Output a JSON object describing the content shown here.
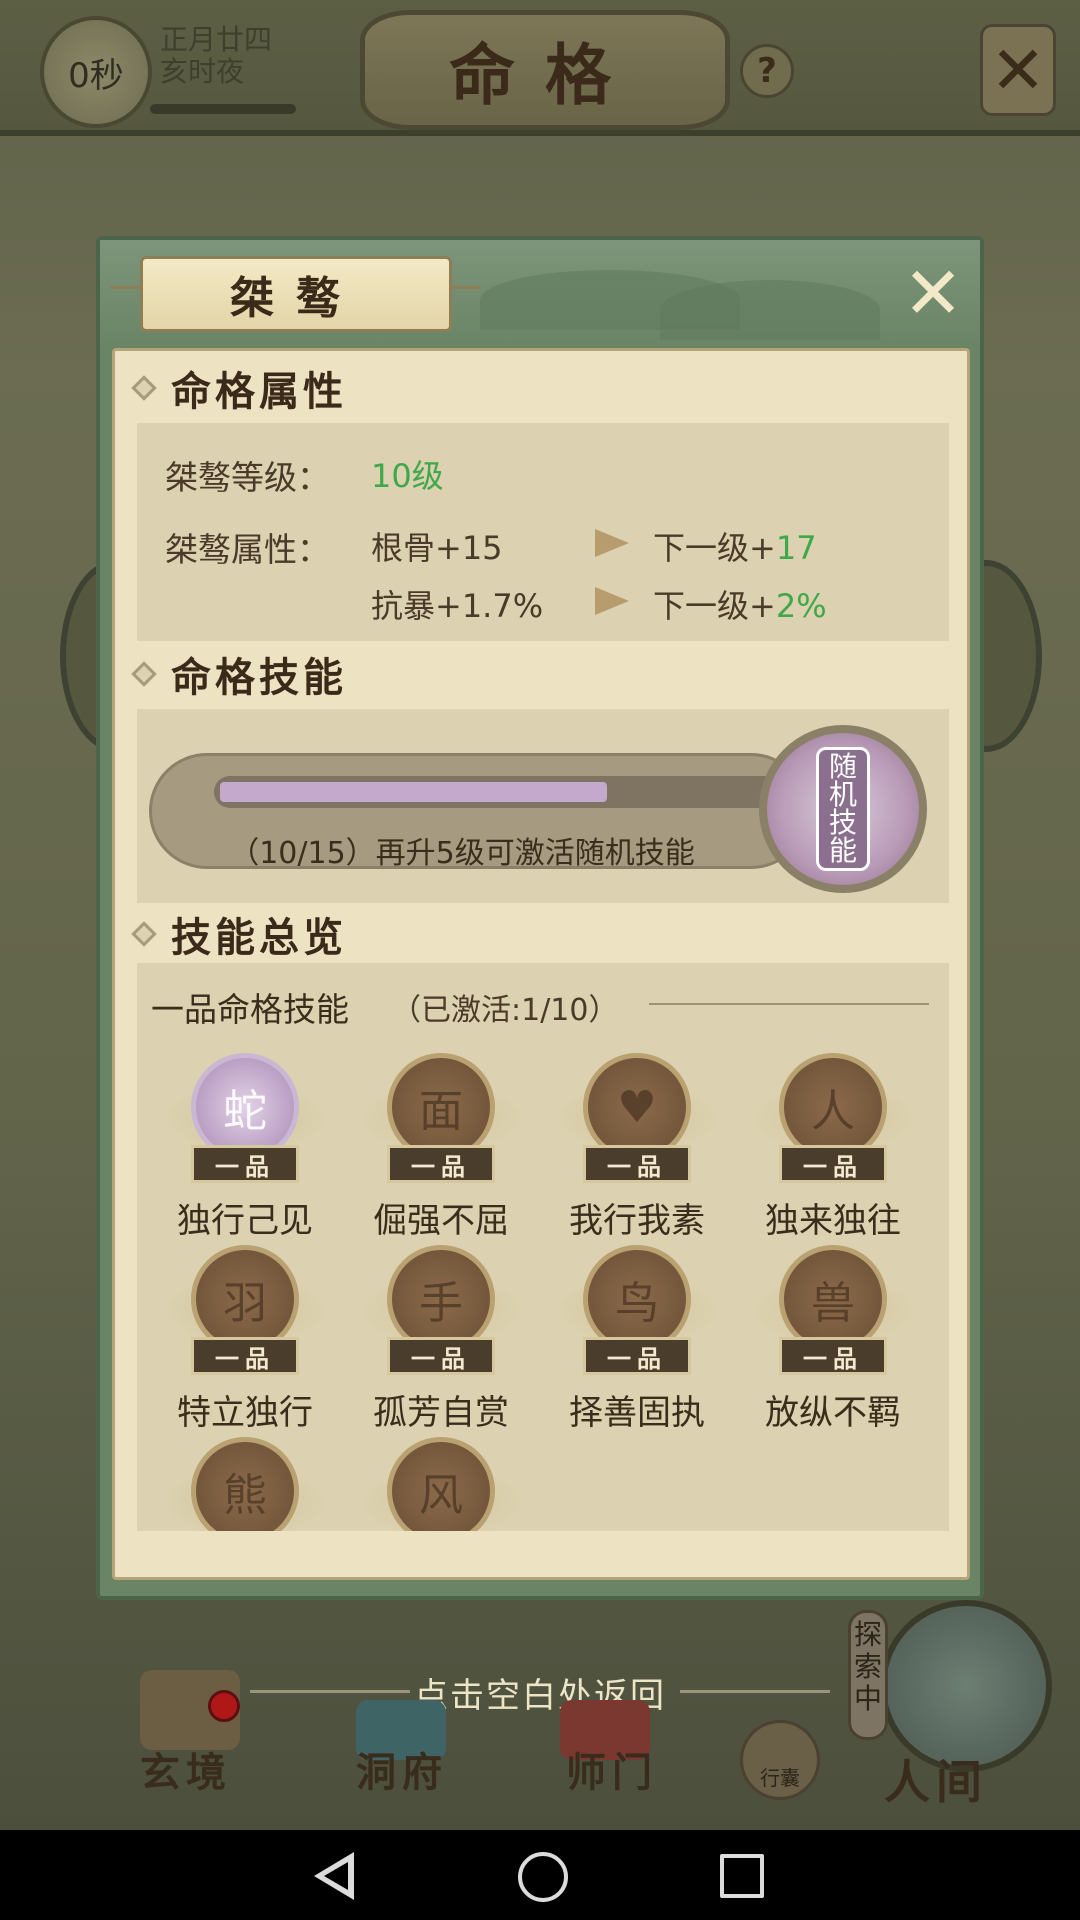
{
  "topbar": {
    "timer": "0秒",
    "date_line1": "正月廿四",
    "date_line2": "亥时夜",
    "title": "命格",
    "help": "?"
  },
  "dialog": {
    "name": "桀骜",
    "close": "✕",
    "attributes": {
      "heading": "命格属性",
      "level_label": "桀骜等级：",
      "level_value": "10级",
      "attr_label": "桀骜属性：",
      "rows": [
        {
          "stat": "根骨+15",
          "next_prefix": "下一级+",
          "next_value": "17"
        },
        {
          "stat": "抗暴+1.7%",
          "next_prefix": "下一级+",
          "next_value": "2%"
        }
      ]
    },
    "skill": {
      "heading": "命格技能",
      "progress_text": "（10/15）再升5级可激活随机技能",
      "progress_fraction": 0.67,
      "badge_text": [
        "随",
        "机",
        "技",
        "能"
      ]
    },
    "overview": {
      "heading": "技能总览",
      "grade_title": "一品命格技能",
      "activated": "（已激活:1/10）",
      "grade_tag": "一品",
      "skills": [
        {
          "name": "独行己见",
          "active": true,
          "glyph": "蛇"
        },
        {
          "name": "倔强不屈",
          "active": false,
          "glyph": "面"
        },
        {
          "name": "我行我素",
          "active": false,
          "glyph": "♥"
        },
        {
          "name": "独来独往",
          "active": false,
          "glyph": "人"
        },
        {
          "name": "特立独行",
          "active": false,
          "glyph": "羽"
        },
        {
          "name": "孤芳自赏",
          "active": false,
          "glyph": "手"
        },
        {
          "name": "择善固执",
          "active": false,
          "glyph": "鸟"
        },
        {
          "name": "放纵不羁",
          "active": false,
          "glyph": "兽"
        },
        {
          "name": "",
          "active": false,
          "glyph": "熊"
        },
        {
          "name": "",
          "active": false,
          "glyph": "风"
        }
      ]
    }
  },
  "return_hint": "点击空白处返回",
  "bottom_nav": {
    "items": [
      "玄境",
      "洞府",
      "师门"
    ],
    "explore": [
      "探",
      "索",
      "中"
    ],
    "bag": "行囊",
    "world": "人间"
  }
}
